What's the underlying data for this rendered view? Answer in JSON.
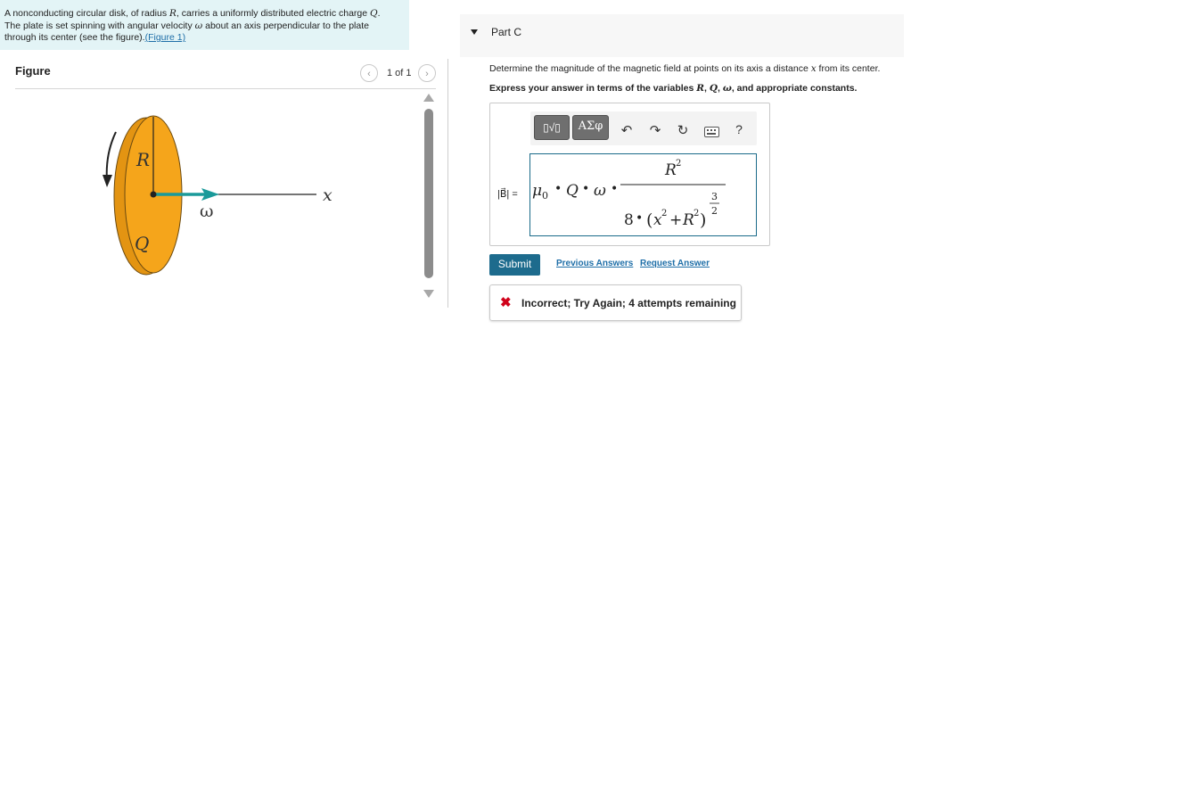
{
  "problem": {
    "text_segments": [
      "A nonconducting circular disk, of radius ",
      "R",
      ", carries a uniformly distributed electric charge ",
      "Q",
      ".",
      "The plate is set spinning with angular velocity ",
      "ω",
      " about an axis perpendicular to the plate",
      "through its center (see the figure).",
      "(Figure 1)"
    ]
  },
  "figure": {
    "title": "Figure",
    "pager": {
      "prev_icon": "‹",
      "count": "1 of 1",
      "next_icon": "›"
    },
    "labels": {
      "radius": "R",
      "charge": "Q",
      "omega": "ω",
      "axis": "x"
    },
    "colors": {
      "disk": "#f5a51b",
      "arrow": "#1a9a9a"
    }
  },
  "part": {
    "caret_icon": "triangle-down",
    "title": "Part C",
    "question_parts": [
      "Determine the magnitude of the magnetic field at points on its axis a distance ",
      "x",
      " from its center."
    ],
    "instruction_parts": [
      "Express your answer in terms of the variables ",
      "R",
      ", ",
      "Q",
      ", ",
      "ω",
      ", and appropriate constants."
    ]
  },
  "toolbar": {
    "template_label": "▯√▯",
    "greek_label": "ΑΣφ",
    "undo": "↶",
    "redo": "↷",
    "reset": "↻",
    "keyboard": "keyboard",
    "help": "?"
  },
  "answer": {
    "label": "|B⃗| =",
    "expr": {
      "mu": "μ",
      "mu_sub": "0",
      "dot": "•",
      "Q": "Q",
      "omega": "ω",
      "num_R": "R",
      "num_exp": "2",
      "den_8": "8",
      "den_x": "x",
      "den_R": "R",
      "den_exp_num": "3",
      "den_exp_den": "2"
    }
  },
  "actions": {
    "submit": "Submit",
    "previous_answers": "Previous Answers",
    "request_answer": "Request Answer"
  },
  "feedback": {
    "icon": "✖",
    "text": "Incorrect; Try Again; 4 attempts remaining",
    "color": "#d0021b"
  }
}
